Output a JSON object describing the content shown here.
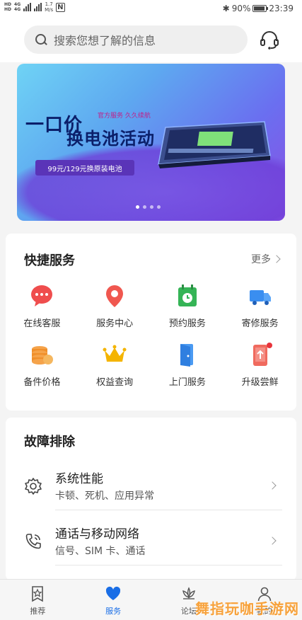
{
  "status_bar": {
    "hd1": "HD",
    "hd2": "HD",
    "net1": "4G",
    "net2": "4G",
    "speed_value": "1.7",
    "speed_unit": "M/s",
    "nfc": "N",
    "bluetooth": "✱",
    "battery_percent": "90%",
    "battery_level": 0.9,
    "time": "23:39"
  },
  "header": {
    "search_placeholder": "搜索您想了解的信息",
    "icons": [
      "search-icon",
      "headset-icon"
    ]
  },
  "banner": {
    "title_line1": "一口价",
    "title_line2": "换电池活动",
    "tag": "官方服务  久久续航",
    "price_text": "99元/129元换原装电池",
    "page_count": 4,
    "active_page": 1,
    "colors": {
      "start": "#6fd3f5",
      "mid": "#6a6ff0",
      "end": "#8b4fe3",
      "title": "#0b1f6a",
      "price_bg": "#5a34b8"
    }
  },
  "quick_services": {
    "title": "快捷服务",
    "more_label": "更多",
    "items": [
      {
        "label": "在线客服",
        "icon": "chat-bubble-icon"
      },
      {
        "label": "服务中心",
        "icon": "location-pin-icon"
      },
      {
        "label": "预约服务",
        "icon": "calendar-clock-icon"
      },
      {
        "label": "寄修服务",
        "icon": "truck-icon"
      },
      {
        "label": "备件价格",
        "icon": "coins-icon"
      },
      {
        "label": "权益查询",
        "icon": "crown-icon"
      },
      {
        "label": "上门服务",
        "icon": "door-icon"
      },
      {
        "label": "升级尝鲜",
        "icon": "upgrade-phone-icon",
        "badge": true
      }
    ]
  },
  "troubleshooting": {
    "title": "故障排除",
    "items": [
      {
        "title": "系统性能",
        "subtitle": "卡顿、死机、应用异常",
        "icon": "gear-icon"
      },
      {
        "title": "通话与移动网络",
        "subtitle": "信号、SIM 卡、通话",
        "icon": "phone-call-icon"
      }
    ]
  },
  "bottom_nav": {
    "items": [
      {
        "label": "推荐",
        "icon": "star-bookmark-icon",
        "active": false
      },
      {
        "label": "服务",
        "icon": "heart-icon",
        "active": true
      },
      {
        "label": "论坛",
        "icon": "lotus-icon",
        "active": false
      },
      {
        "label": "我的",
        "icon": "person-icon",
        "active": false
      }
    ]
  },
  "watermark": "舞指玩咖手游网",
  "colors": {
    "accent": "#1a6ee6",
    "badge": "#e8343b"
  }
}
